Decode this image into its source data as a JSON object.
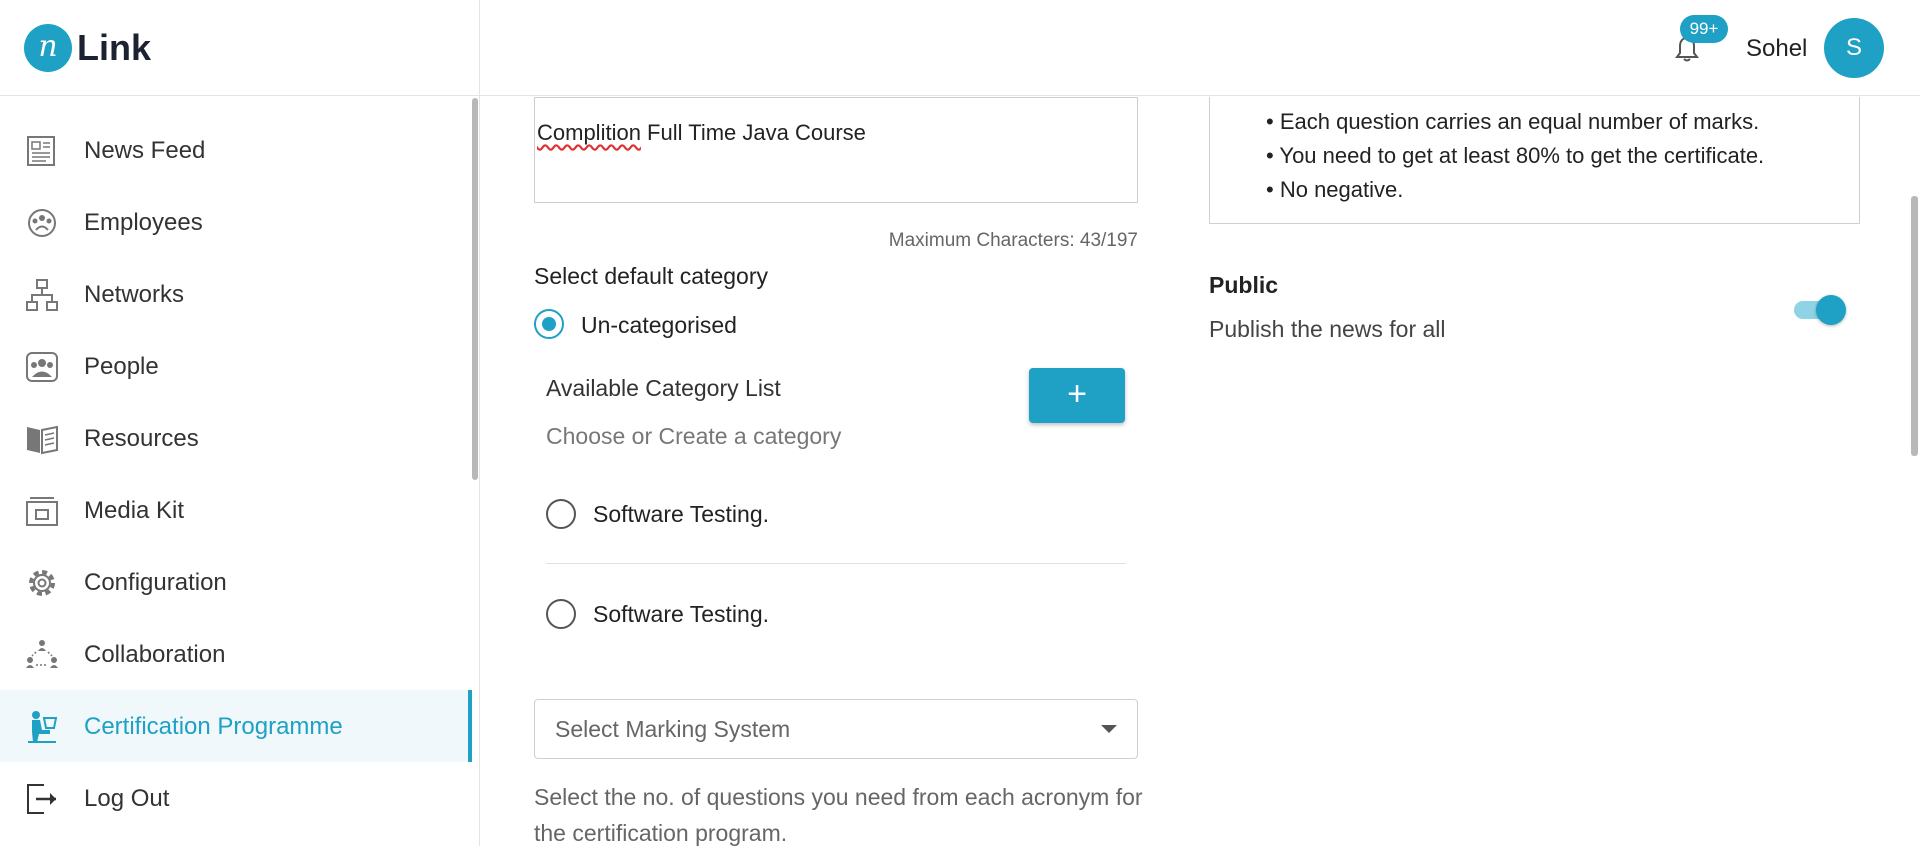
{
  "header": {
    "logo_letter": "n",
    "logo_text": "Link",
    "notification_badge": "99+",
    "user_name": "Sohel",
    "avatar_initial": "S"
  },
  "sidebar": {
    "items": [
      {
        "label": "News Feed",
        "icon": "news-feed-icon"
      },
      {
        "label": "Employees",
        "icon": "employees-icon"
      },
      {
        "label": "Networks",
        "icon": "networks-icon"
      },
      {
        "label": "People",
        "icon": "people-icon"
      },
      {
        "label": "Resources",
        "icon": "resources-icon"
      },
      {
        "label": "Media Kit",
        "icon": "media-kit-icon"
      },
      {
        "label": "Configuration",
        "icon": "gear-icon"
      },
      {
        "label": "Collaboration",
        "icon": "collaboration-icon"
      },
      {
        "label": "Certification Programme",
        "icon": "certification-icon",
        "active": true
      },
      {
        "label": "Log Out",
        "icon": "logout-icon"
      }
    ]
  },
  "form": {
    "title_value_misspelled": "Complition",
    "title_value_rest": " Full Time Java Course",
    "max_chars": "Maximum Characters: 43/197",
    "category_heading": "Select default category",
    "default_category": "Un-categorised",
    "available_list_label": "Available Category List",
    "choose_placeholder": "Choose or Create a category",
    "add_button": "+",
    "categories": [
      "Software Testing.",
      "Software Testing."
    ],
    "marking_select_placeholder": "Select Marking System",
    "help_text": "Select the no. of questions you need from each acronym for the certification program."
  },
  "rules": [
    "Each question carries an equal number of marks.",
    "You need to get at least 80% to get the certificate.",
    "No negative."
  ],
  "public": {
    "title": "Public",
    "description": "Publish the news for all",
    "enabled": true
  },
  "colors": {
    "accent": "#1ea1c5",
    "text": "#222222",
    "muted": "#666666",
    "border": "#cfcfcf"
  }
}
